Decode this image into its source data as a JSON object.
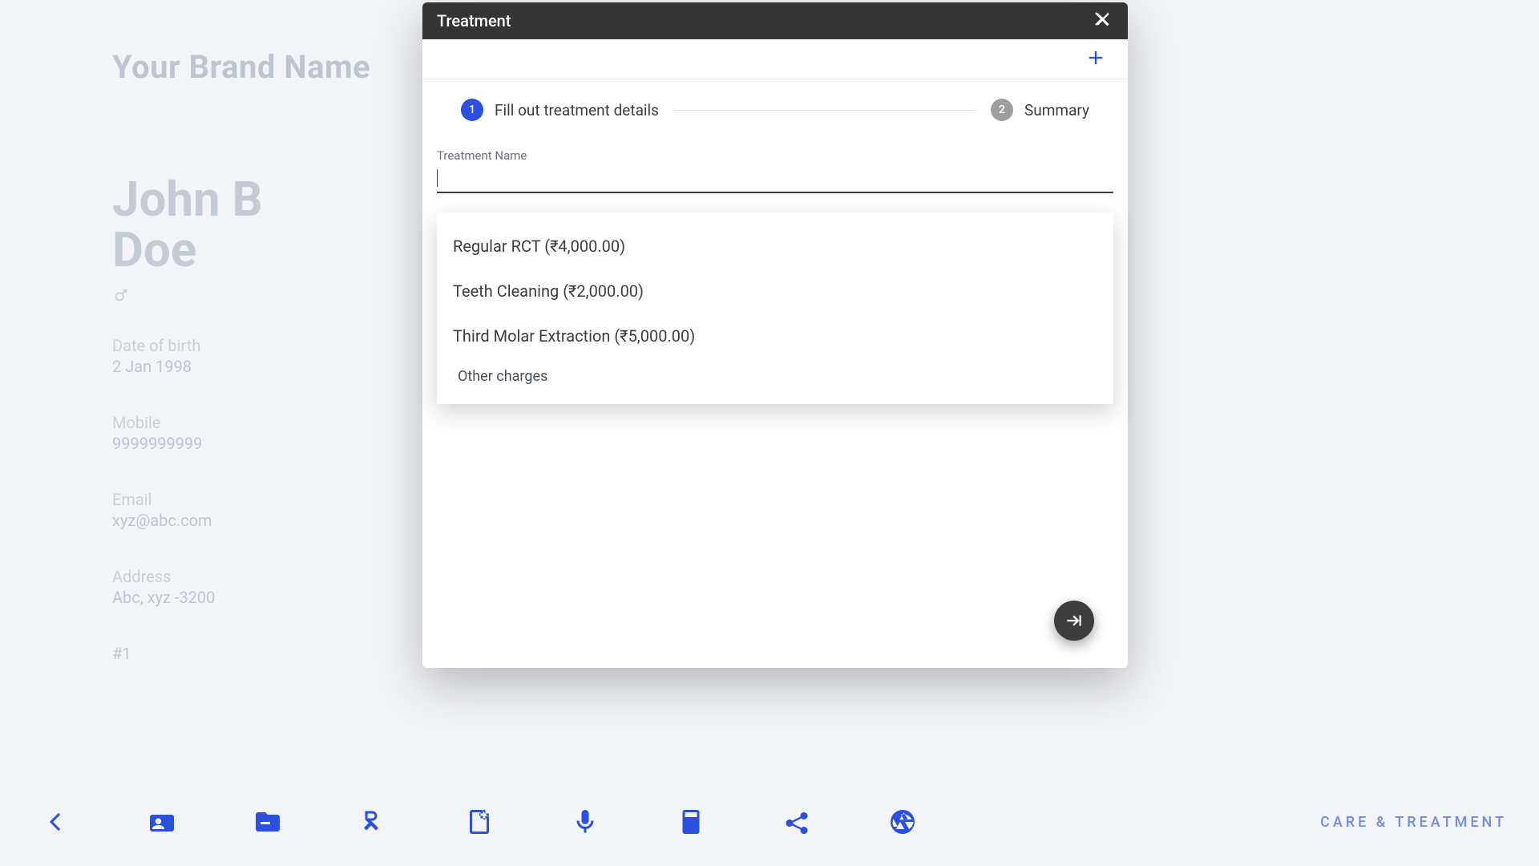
{
  "brand": "Your Brand Name",
  "patient": {
    "name": "John B Doe",
    "dob_label": "Date of birth",
    "dob": "2 Jan 1998",
    "mobile_label": "Mobile",
    "mobile": "9999999999",
    "email_label": "Email",
    "email": "xyz@abc.com",
    "address_label": "Address",
    "address": "Abc, xyz -3200",
    "id": "#1"
  },
  "modal": {
    "title": "Treatment",
    "stepper": {
      "step1_index": "1",
      "step1_label": "Fill out treatment details",
      "step2_index": "2",
      "step2_label": "Summary"
    },
    "field_label": "Treatment Name",
    "field_value": "",
    "options": [
      "Regular RCT (₹4,000.00)",
      "Teeth Cleaning (₹2,000.00)",
      "Third Molar Extraction (₹5,000.00)",
      "Other charges"
    ]
  },
  "footer": {
    "label": "CARE & TREATMENT"
  },
  "colors": {
    "accent": "#2b4fe1"
  }
}
